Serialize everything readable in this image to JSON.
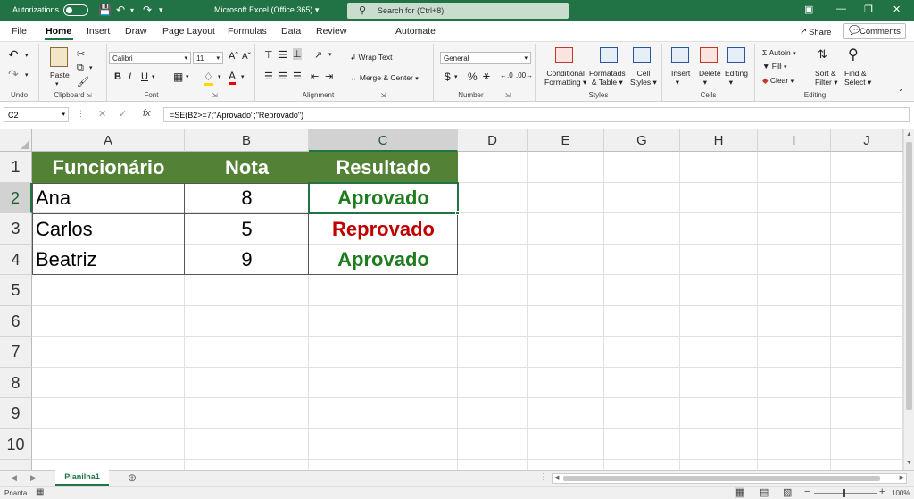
{
  "titlebar": {
    "autosave_label": "Autorizations",
    "title": "Microsoft Excel (Office 365)",
    "title_caret": "▾",
    "search_placeholder": "Search for (Ctrl+8)"
  },
  "tabs": [
    "File",
    "Home",
    "Insert",
    "Draw",
    "Page Layout",
    "Formulas",
    "Data",
    "Review",
    "Automate"
  ],
  "share_label": "Share",
  "comments_label": "Comments",
  "ribbon": {
    "undo_label": "Undo",
    "clipboard": {
      "paste": "Paste",
      "label": "Clipboard"
    },
    "font": {
      "name": "Calibri",
      "size": "11",
      "label": "Font"
    },
    "alignment": {
      "wrap": "Wrap Text",
      "merge": "Merge & Center",
      "label": "Alignment"
    },
    "number": {
      "format": "General",
      "label": "Number"
    },
    "styles": {
      "conditional1": "Conditional",
      "conditional2": "Formatting",
      "formatas1": "Formatads",
      "formatas2": "& Table",
      "cell1": "Cell",
      "cell2": "Styles",
      "label": "Styles"
    },
    "cells": {
      "insert": "Insert",
      "delete": "Delete",
      "editing": "Editing",
      "label": "Cells"
    },
    "editing": {
      "autosum": "Autoin",
      "fill": "Fill",
      "clear": "Clear",
      "sort1": "Sort &",
      "sort2": "Filter",
      "find1": "Find &",
      "find2": "Select",
      "label": "Editing"
    }
  },
  "formula_bar": {
    "name_box": "C2",
    "formula": "=SE(B2>=7;\"Aprovado\";\"Reprovado\")"
  },
  "columns": [
    "A",
    "B",
    "C",
    "D",
    "E",
    "G",
    "H",
    "I",
    "J"
  ],
  "rows": [
    "1",
    "2",
    "3",
    "4",
    "5",
    "6",
    "7",
    "8",
    "9",
    "10"
  ],
  "table": {
    "headers": [
      "Funcionário",
      "Nota",
      "Resultado"
    ],
    "data": [
      {
        "name": "Ana",
        "nota": "8",
        "resultado": "Aprovado"
      },
      {
        "name": "Carlos",
        "nota": "5",
        "resultado": "Reprovado"
      },
      {
        "name": "Beatriz",
        "nota": "9",
        "resultado": "Aprovado"
      }
    ]
  },
  "colors": {
    "header_bg": "#538135",
    "pass": "#1e7b1e",
    "fail": "#c00000",
    "accent": "#217346"
  },
  "sheet_tab": "Planilha1",
  "status": {
    "mode": "Pnanta",
    "zoom": "100%"
  }
}
